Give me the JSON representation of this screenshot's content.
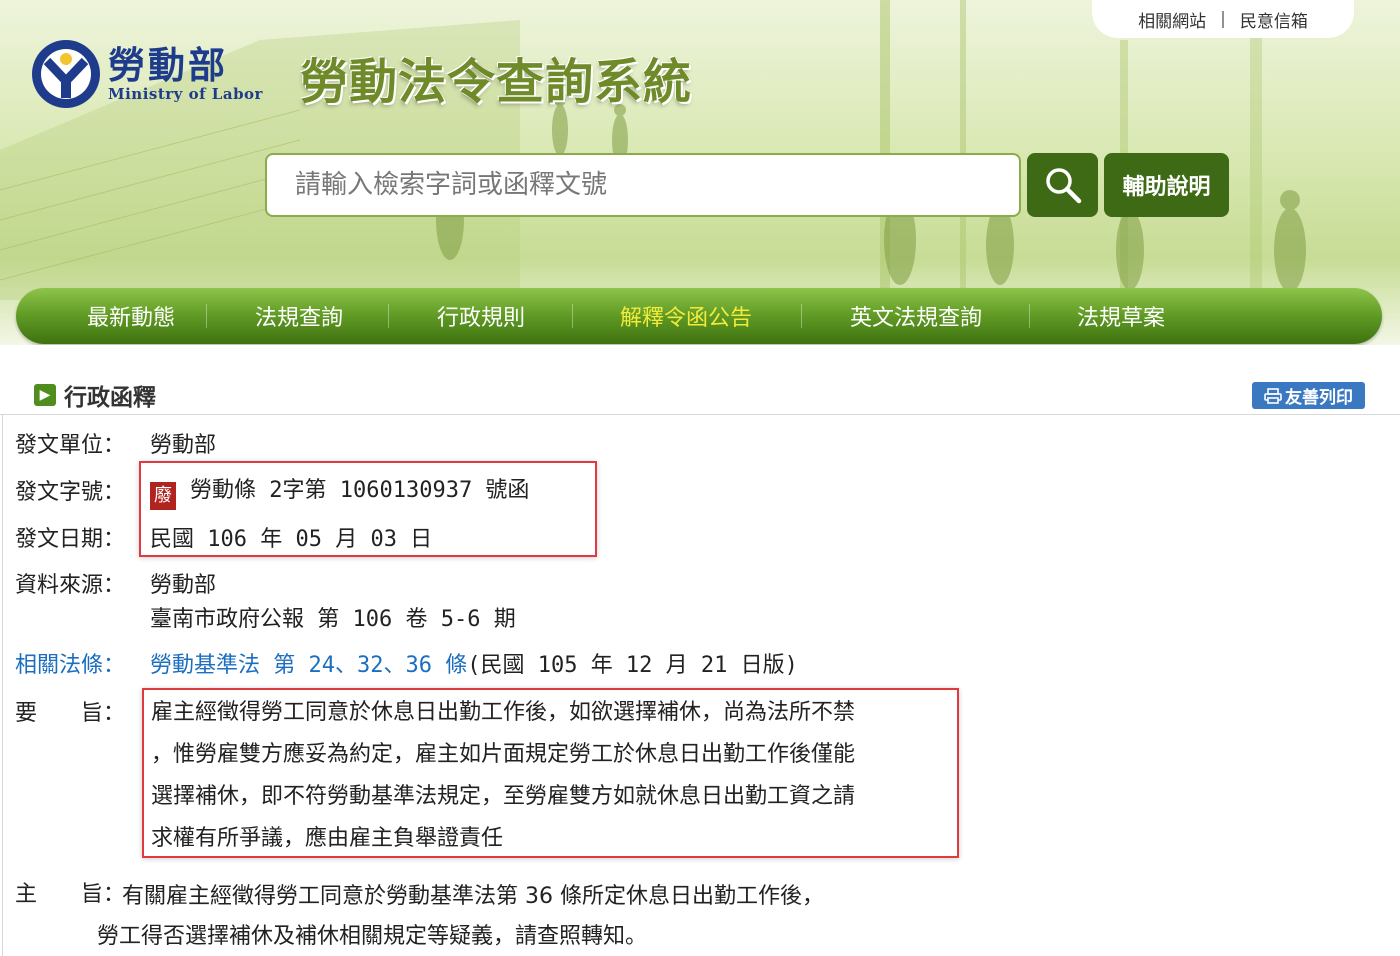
{
  "header": {
    "top_links": [
      "相關網站",
      "民意信箱"
    ],
    "logo_zh": "勞動部",
    "logo_en": "Ministry of Labor",
    "system_title": "勞動法令查詢系統",
    "search_placeholder": "請輸入檢索字詞或函釋文號",
    "help_label": "輔助說明"
  },
  "nav": {
    "items": [
      "最新動態",
      "法規查詢",
      "行政規則",
      "解釋令函公告",
      "英文法規查詢",
      "法規草案"
    ],
    "active": "解釋令函公告"
  },
  "section": {
    "title": "行政函釋",
    "print_label": "友善列印"
  },
  "record": {
    "issuer_label": "發文單位：",
    "issuer": "勞動部",
    "number_label": "發文字號：",
    "status_badge": "廢",
    "number": "勞動條 2字第 1060130937 號函",
    "date_label": "發文日期：",
    "date": "民國 106 年 05 月 03 日",
    "source_label": "資料來源：",
    "source_line1": "勞動部",
    "source_line2": "臺南市政府公報 第 106 卷 5-6 期",
    "law_label": "相關法條：",
    "law_link": "勞動基準法 第 24、32、36 條",
    "law_version": "(民國 105 年 12 月 21 日版)",
    "summary_label": "要　　旨：",
    "summary_lines": [
      "雇主經徵得勞工同意於休息日出勤工作後，如欲選擇補休，尚為法所不禁",
      "，惟勞雇雙方應妥為約定，雇主如片面規定勞工於休息日出勤工作後僅能",
      "選擇補休，即不符勞動基準法規定，至勞雇雙方如就休息日出勤工資之請",
      "求權有所爭議，應由雇主負舉證責任"
    ],
    "main_label": "主　　旨：",
    "main_line1": "有關雇主經徵得勞工同意於勞動基準法第 36 條所定休息日出勤工作後，",
    "main_line2": "勞工得否選擇補休及補休相關規定等疑義，請查照轉知。"
  },
  "colors": {
    "nav_active": "#f3ea3c",
    "link_blue": "#1c6ec0",
    "highlight_red": "#e03a3e",
    "brand_green": "#3e6a16"
  }
}
